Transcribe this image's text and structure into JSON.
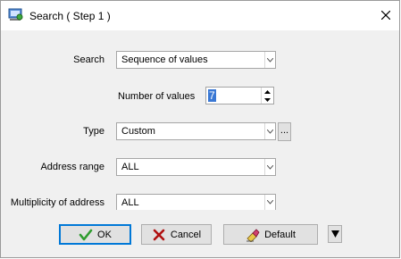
{
  "window": {
    "title": "Search ( Step 1 )",
    "icon": "search-dialog-icon",
    "close_icon": "close-icon"
  },
  "form": {
    "search": {
      "label": "Search",
      "value": "Sequence of values"
    },
    "number_of_values": {
      "label": "Number of values",
      "value": "7"
    },
    "type": {
      "label": "Type",
      "value": "Custom",
      "browse_label": "..."
    },
    "address_range": {
      "label": "Address range",
      "value": "ALL"
    },
    "multiplicity": {
      "label": "Multiplicity of address",
      "value": "ALL"
    }
  },
  "buttons": {
    "ok": {
      "label": "OK",
      "icon": "checkmark-icon"
    },
    "cancel": {
      "label": "Cancel",
      "icon": "x-icon"
    },
    "default": {
      "label": "Default",
      "icon": "eraser-icon"
    },
    "more": {
      "icon": "triangle-down-icon"
    }
  },
  "colors": {
    "window_bg": "#f0f0f0",
    "selection": "#3a78d4",
    "focus_border": "#0078d7",
    "ok_check": "#2e9c2e",
    "cancel_x": "#b01010"
  }
}
